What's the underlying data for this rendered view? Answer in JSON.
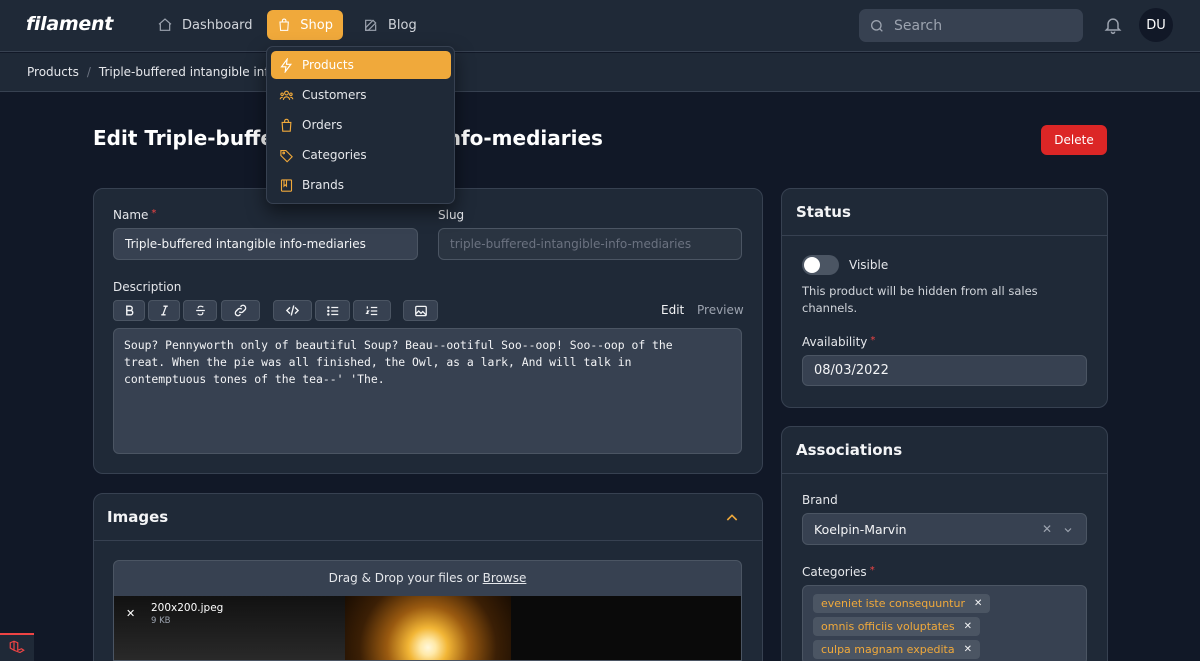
{
  "app": {
    "logo": "filament"
  },
  "nav": {
    "items": [
      {
        "label": "Dashboard",
        "icon": "home-icon"
      },
      {
        "label": "Shop",
        "icon": "shopping-bag-icon",
        "active": true
      },
      {
        "label": "Blog",
        "icon": "pencil-icon"
      }
    ],
    "search_placeholder": "Search",
    "avatar_initials": "DU"
  },
  "breadcrumb": {
    "items": [
      "Products",
      "Triple-buffered intangible info-mediaries"
    ]
  },
  "dropdown": {
    "items": [
      {
        "label": "Products",
        "icon": "bolt-icon",
        "active": true
      },
      {
        "label": "Customers",
        "icon": "users-icon"
      },
      {
        "label": "Orders",
        "icon": "shopping-bag-icon"
      },
      {
        "label": "Categories",
        "icon": "tag-icon"
      },
      {
        "label": "Brands",
        "icon": "book-icon"
      }
    ]
  },
  "page": {
    "title": "Edit Triple-buffered intangible info-mediaries",
    "delete_label": "Delete"
  },
  "form": {
    "name_label": "Name",
    "required_mark": "*",
    "name_value": "Triple-buffered intangible info-mediaries",
    "slug_label": "Slug",
    "slug_value": "triple-buffered-intangible-info-mediaries",
    "description_label": "Description",
    "toolbar_icons": [
      "bold-icon",
      "italic-icon",
      "strikethrough-icon",
      "link-icon",
      "code-icon",
      "bullet-list-icon",
      "numbered-list-icon",
      "image-icon"
    ],
    "edit_tab": "Edit",
    "preview_tab": "Preview",
    "description_value": "Soup? Pennyworth only of beautiful Soup? Beau--ootiful Soo--oop! Soo--oop of the\ntreat. When the pie was all finished, the Owl, as a lark, And will talk in\ncontemptuous tones of the tea--' 'The."
  },
  "images": {
    "title": "Images",
    "dropzone_text": "Drag & Drop your files or",
    "browse_label": "Browse",
    "file_name": "200x200.jpeg",
    "file_size": "9 KB"
  },
  "status": {
    "title": "Status",
    "visible_label": "Visible",
    "visible_on": false,
    "visible_help": "This product will be hidden from all sales channels.",
    "availability_label": "Availability",
    "availability_value": "08/03/2022"
  },
  "associations": {
    "title": "Associations",
    "brand_label": "Brand",
    "brand_value": "Koelpin-Marvin",
    "categories_label": "Categories",
    "categories": [
      "eveniet iste consequuntur",
      "omnis officiis voluptates",
      "culpa magnam expedita"
    ]
  },
  "colors": {
    "accent": "#f0a93b",
    "danger": "#dc2626",
    "background": "#111827",
    "surface": "#1f2937"
  }
}
